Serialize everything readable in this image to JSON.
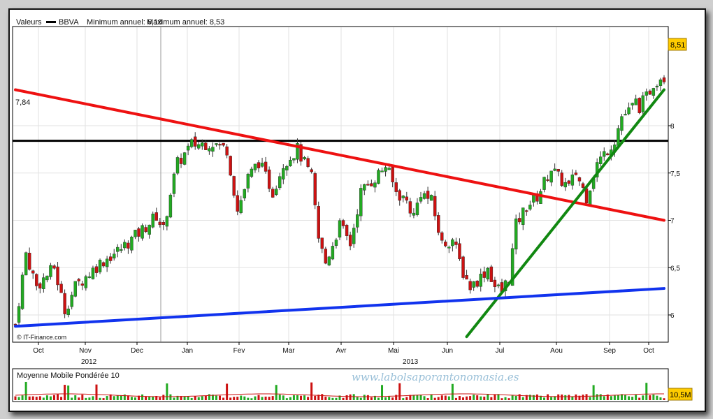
{
  "header": {
    "label_values": "Valeurs",
    "ticker": "BBVA",
    "min_label": "Minimum annuel: 6,18",
    "max_label": "Maximum annuel: 8,53"
  },
  "source": "© IT-Finance.com",
  "watermark": "www.labolsaporantonomasia.es",
  "volume_panel": {
    "title": "Moyenne Mobile Pondérée 10",
    "last_value_label": "10,5M"
  },
  "last_price_label": "8,51",
  "resistance_label": "7,84",
  "colors": {
    "up_candle": "#22aa22",
    "down_candle": "#cc1111",
    "downtrend_line": "#ee1111",
    "uptrend_line": "#118811",
    "support_line": "#1133ee",
    "horizontal_line": "#000000",
    "price_badge": "#ffcc00"
  },
  "chart_data": {
    "type": "candlestick",
    "x_tick_labels": [
      "Oct",
      "Nov",
      "Dec",
      "Jan",
      "Fev",
      "Mar",
      "Avr",
      "Mai",
      "Jun",
      "Jul",
      "Aou",
      "Sep",
      "Oct"
    ],
    "year_labels": [
      "2012",
      "2013"
    ],
    "y_tick_labels": [
      "6",
      "6,5",
      "7",
      "7,5",
      "8"
    ],
    "y_ticks": [
      6,
      6.5,
      7,
      7.5,
      8
    ],
    "ylim": [
      5.8,
      8.7
    ],
    "close_path": [
      [
        0,
        5.9
      ],
      [
        3,
        6.65
      ],
      [
        6,
        6.3
      ],
      [
        11,
        6.5
      ],
      [
        14,
        6.05
      ],
      [
        17,
        6.3
      ],
      [
        24,
        6.55
      ],
      [
        30,
        6.7
      ],
      [
        36,
        6.9
      ],
      [
        40,
        7.05
      ],
      [
        42,
        6.9
      ],
      [
        44,
        7.3
      ],
      [
        46,
        7.6
      ],
      [
        50,
        7.8
      ],
      [
        56,
        7.82
      ],
      [
        60,
        7.75
      ],
      [
        63,
        7.1
      ],
      [
        66,
        7.45
      ],
      [
        69,
        7.62
      ],
      [
        73,
        7.3
      ],
      [
        76,
        7.6
      ],
      [
        80,
        7.75
      ],
      [
        84,
        7.45
      ],
      [
        86,
        6.8
      ],
      [
        88,
        6.55
      ],
      [
        92,
        6.95
      ],
      [
        95,
        6.75
      ],
      [
        98,
        7.3
      ],
      [
        102,
        7.45
      ],
      [
        105,
        7.58
      ],
      [
        108,
        7.3
      ],
      [
        111,
        7.2
      ],
      [
        113,
        7.05
      ],
      [
        115,
        7.3
      ],
      [
        118,
        7.2
      ],
      [
        121,
        6.75
      ],
      [
        124,
        6.8
      ],
      [
        127,
        6.45
      ],
      [
        129,
        6.3
      ],
      [
        132,
        6.4
      ],
      [
        134,
        6.5
      ],
      [
        136,
        6.3
      ],
      [
        138,
        6.25
      ],
      [
        140,
        6.4
      ],
      [
        142,
        6.95
      ],
      [
        145,
        7.15
      ],
      [
        148,
        7.25
      ],
      [
        152,
        7.55
      ],
      [
        154,
        7.45
      ],
      [
        157,
        7.35
      ],
      [
        159,
        7.5
      ],
      [
        162,
        7.25
      ],
      [
        165,
        7.6
      ],
      [
        167,
        7.7
      ],
      [
        170,
        7.85
      ],
      [
        172,
        8.1
      ],
      [
        174,
        8.15
      ],
      [
        176,
        8.25
      ],
      [
        177,
        8.2
      ],
      [
        179,
        8.3
      ],
      [
        181,
        8.45
      ],
      [
        183,
        8.52
      ],
      [
        184,
        8.51
      ]
    ],
    "horizontal_level": 7.84,
    "downtrend_line": {
      "from": [
        0,
        8.38
      ],
      "to": [
        184,
        7.0
      ]
    },
    "uptrend_line": {
      "from": [
        128,
        5.77
      ],
      "to": [
        184,
        8.38
      ]
    },
    "support_line": {
      "from": [
        0,
        5.88
      ],
      "to": [
        184,
        6.28
      ]
    },
    "x_range": [
      0,
      184
    ],
    "volume_panel_title": "Moyenne Mobile Pondérée 10"
  }
}
